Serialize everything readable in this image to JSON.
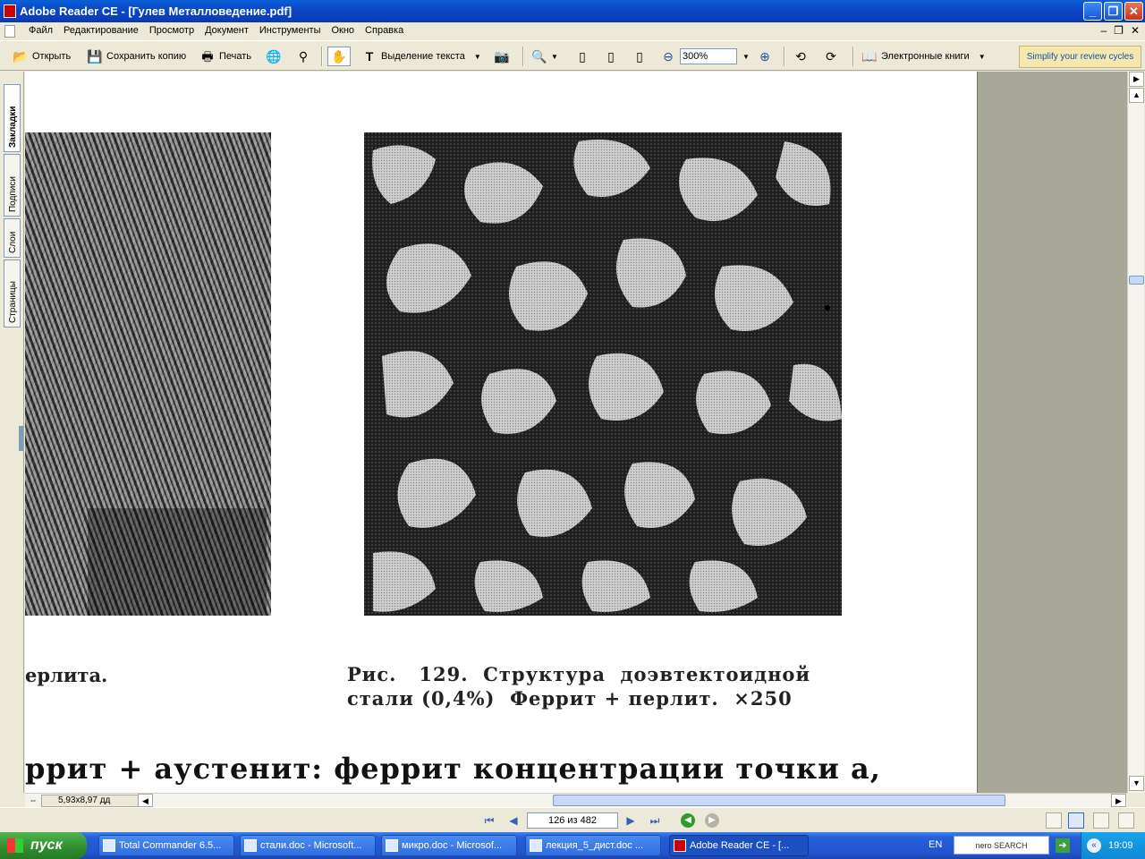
{
  "window": {
    "title": "Adobe Reader CE - [Гулев Металловедение.pdf]"
  },
  "menu": [
    "Файл",
    "Редактирование",
    "Просмотр",
    "Документ",
    "Инструменты",
    "Окно",
    "Справка"
  ],
  "toolbar": {
    "open": "Открыть",
    "save_copy": "Сохранить копию",
    "print": "Печать",
    "select_text": "Выделение текста",
    "zoom": "300%",
    "ebooks": "Электронные книги",
    "promo": "Simplify your review cycles"
  },
  "side_tabs": [
    "Закладки",
    "Подписи",
    "Слои",
    "Страницы"
  ],
  "document": {
    "caption_left": "ерлита.",
    "caption_right_line1": "Рис.   129.  Структура  доэвтектоидной",
    "caption_right_line2": "стали (0,4%)  Феррит + перлит.  ×250",
    "body_line": "ррит + аустенит: феррит концентрации точки a,"
  },
  "status": {
    "page_size": "5,93x8,97 дд",
    "page_indicator": "126 из 482"
  },
  "taskbar": {
    "start": "пуск",
    "tasks": [
      "Total Commander 6.5...",
      "стали.doc - Microsoft...",
      "микро.doc - Microsof...",
      "лекция_5_дист.doc ...",
      "Adobe Reader CE - [..."
    ],
    "lang": "EN",
    "search": "nero SEARCH",
    "clock": "19:09"
  }
}
